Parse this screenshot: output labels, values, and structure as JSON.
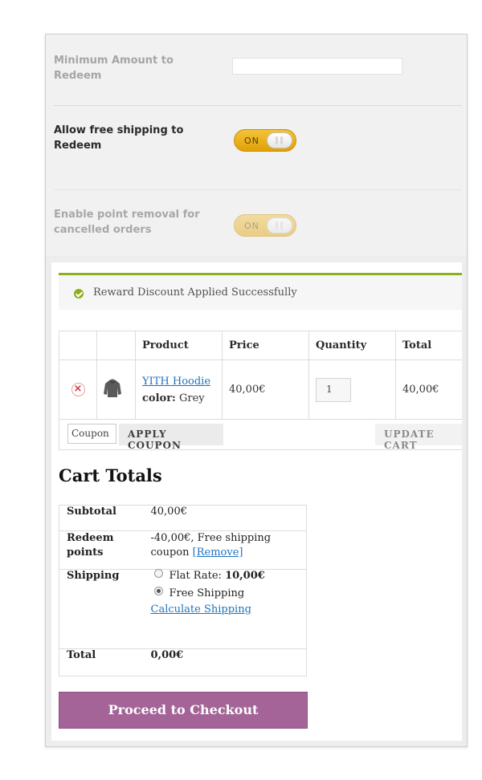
{
  "settings": {
    "min_amount_label": "Minimum Amount to Redeem",
    "min_amount_value": "",
    "free_shipping_label": "Allow free shipping to Redeem",
    "free_shipping_toggle": "ON",
    "point_removal_label": "Enable point removal for cancelled orders",
    "point_removal_toggle": "ON"
  },
  "cart": {
    "notice": "Reward Discount Applied Successfully",
    "headers": {
      "product": "Product",
      "price": "Price",
      "quantity": "Quantity",
      "total": "Total"
    },
    "item": {
      "name": "YITH Hoodie",
      "attr_label": "color:",
      "attr_value": "Grey",
      "price": "40,00€",
      "quantity": "1",
      "total": "40,00€"
    },
    "coupon_placeholder": "Coupon",
    "apply_coupon": "APPLY COUPON",
    "update_cart": "UPDATE CART"
  },
  "totals": {
    "title": "Cart Totals",
    "subtotal_label": "Subtotal",
    "subtotal_value": "40,00€",
    "redeem_label": "Redeem points",
    "redeem_value": "-40,00€, Free shipping coupon",
    "redeem_remove": "[Remove]",
    "shipping_label": "Shipping",
    "flat_rate_label": "Flat Rate:",
    "flat_rate_price": "10,00€",
    "free_shipping": "Free Shipping",
    "calculate_shipping": "Calculate Shipping",
    "total_label": "Total",
    "total_value": "0,00€"
  },
  "checkout_button": "Proceed to Checkout",
  "colors": {
    "accent": "#a46497",
    "toggle": "#e8ad12",
    "success": "#8fae1b",
    "link": "#1e73be"
  }
}
